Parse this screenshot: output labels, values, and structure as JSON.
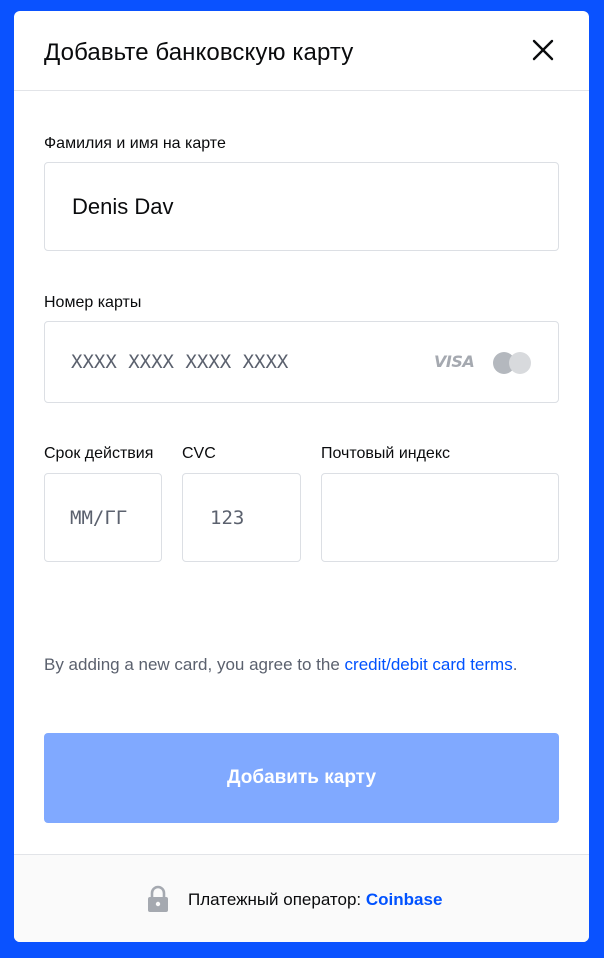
{
  "dialog": {
    "title": "Добавьте банковскую карту"
  },
  "form": {
    "cardholder": {
      "label": "Фамилия и имя на карте",
      "value": "Denis Dav"
    },
    "card_number": {
      "label": "Номер карты",
      "placeholder": "XXXX XXXX XXXX XXXX",
      "brand_visa": "VISA"
    },
    "expiry": {
      "label": "Срок действия",
      "placeholder": "ММ/ГГ"
    },
    "cvc": {
      "label": "CVC",
      "placeholder": "123"
    },
    "postal": {
      "label": "Почтовый индекс",
      "placeholder": ""
    }
  },
  "legal": {
    "prefix": "By adding a new card, you agree to the ",
    "link": "credit/debit card terms",
    "suffix": "."
  },
  "submit_label": "Добавить карту",
  "footer": {
    "text": "Платежный оператор: ",
    "brand": "Coinbase"
  },
  "colors": {
    "background": "#0a52ff",
    "accent": "#0052ff",
    "button_disabled": "#80a9ff",
    "muted_text": "#5b616e",
    "border": "#dcdfe4"
  },
  "icons": {
    "close": "close-icon",
    "card_network": "mastercard-icon",
    "footer": "lock-icon"
  }
}
